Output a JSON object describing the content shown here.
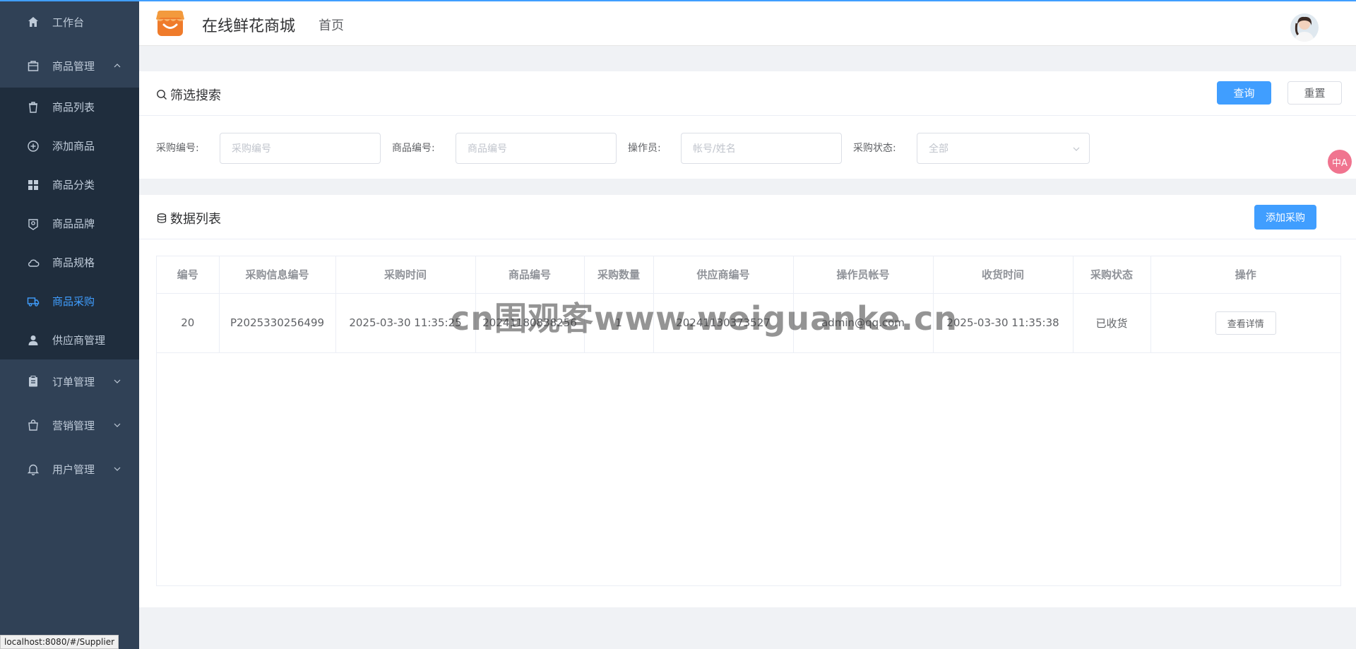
{
  "sidebar": {
    "items": [
      {
        "label": "工作台",
        "icon": "home-icon"
      },
      {
        "label": "商品管理",
        "icon": "bag-icon"
      },
      {
        "label": "订单管理",
        "icon": "clipboard-icon"
      },
      {
        "label": "营销管理",
        "icon": "shopping-bag-icon"
      },
      {
        "label": "用户管理",
        "icon": "bell-icon"
      }
    ],
    "goods_sub": [
      {
        "label": "商品列表",
        "icon": "trash-icon"
      },
      {
        "label": "添加商品",
        "icon": "plus-circle-icon"
      },
      {
        "label": "商品分类",
        "icon": "grid-icon"
      },
      {
        "label": "商品品牌",
        "icon": "tag-icon"
      },
      {
        "label": "商品规格",
        "icon": "cloud-icon"
      },
      {
        "label": "商品采购",
        "icon": "truck-icon"
      },
      {
        "label": "供应商管理",
        "icon": "user-icon"
      }
    ],
    "bg_color": "#304156",
    "active_color": "#409eff"
  },
  "header": {
    "title": "在线鲜花商城",
    "nav_home": "首页"
  },
  "filter": {
    "title": "筛选搜索",
    "query_label": "查询",
    "reset_label": "重置",
    "fields": [
      {
        "label": "采购编号:",
        "placeholder": "采购编号"
      },
      {
        "label": "商品编号:",
        "placeholder": "商品编号"
      },
      {
        "label": "操作员:",
        "placeholder": "帐号/姓名"
      },
      {
        "label": "采购状态:",
        "placeholder": "全部"
      }
    ]
  },
  "list": {
    "title": "数据列表",
    "add_label": "添加采购",
    "columns": [
      "编号",
      "采购信息编号",
      "采购时间",
      "商品编号",
      "采购数量",
      "供应商编号",
      "操作员帐号",
      "收货时间",
      "采购状态",
      "操作"
    ],
    "rows": [
      {
        "id": "20",
        "purchase_no": "P2025330256499",
        "purchase_time": "2025-03-30 11:35:25",
        "goods_no": "20241180838256",
        "quantity": "1",
        "supplier_no": "20241130373527",
        "operator": "admin@qq.com",
        "receive_time": "2025-03-30 11:35:38",
        "status": "已收货",
        "action": "查看详情"
      }
    ]
  },
  "watermark": "cn围观客www.weiguanke.cn",
  "translate_badge": "中A",
  "status_url": "localhost:8080/#/Supplier"
}
